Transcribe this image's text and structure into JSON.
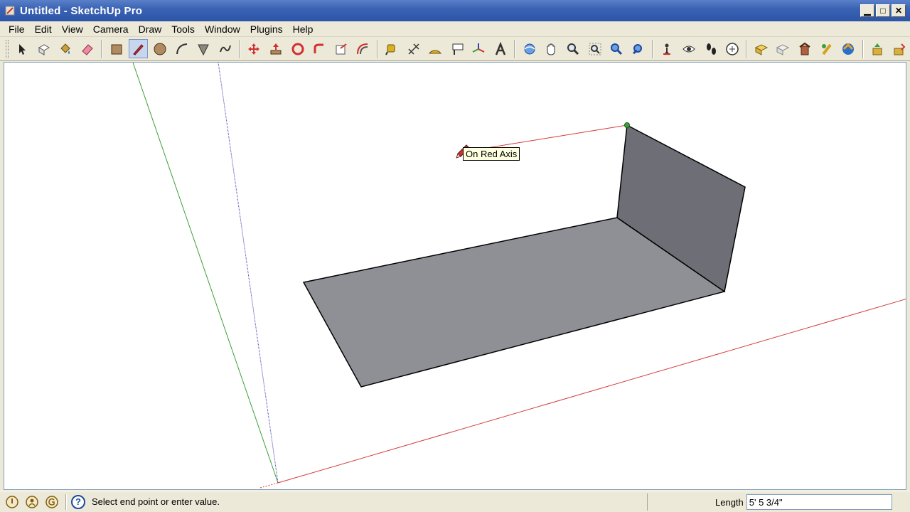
{
  "window": {
    "title": "Untitled - SketchUp Pro",
    "controls": {
      "minimize": "▁",
      "maximize": "□",
      "close": "✕"
    }
  },
  "menu": [
    "File",
    "Edit",
    "View",
    "Camera",
    "Draw",
    "Tools",
    "Window",
    "Plugins",
    "Help"
  ],
  "toolbar": {
    "icons": [
      "select-icon",
      "make-component-icon",
      "paint-bucket-icon",
      "eraser-icon",
      "rectangle-icon",
      "line-pencil-icon",
      "circle-icon",
      "arc-icon",
      "polygon-icon",
      "freehand-icon",
      "move-icon",
      "push-pull-icon",
      "rotate-icon",
      "follow-me-icon",
      "scale-icon",
      "offset-icon",
      "tape-measure-icon",
      "dimension-icon",
      "protractor-icon",
      "text-icon",
      "axes-icon",
      "3d-text-icon",
      "orbit-icon",
      "pan-icon",
      "zoom-icon",
      "zoom-window-icon",
      "zoom-extents-icon",
      "previous-view-icon",
      "position-camera-icon",
      "look-around-icon",
      "walk-icon",
      "section-plane-icon",
      "get-current-view-icon",
      "toggle-terrain-icon",
      "add-new-building-icon",
      "photo-textures-icon",
      "get-models-icon",
      "share-model-icon",
      "share-component-icon"
    ],
    "active_tool": "line-pencil-icon"
  },
  "viewport": {
    "tooltip": "On Red Axis",
    "colors": {
      "red_axis": "#d43c3c",
      "green_axis": "#3aa03a",
      "blue_axis": "#3b3bb0",
      "face_floor": "#8f9096",
      "face_wall": "#6e6e76",
      "endpoint": "#3aa03a"
    }
  },
  "status": {
    "message": "Select end point or enter value.",
    "measurement_label": "Length",
    "measurement_value": "5' 5 3/4\""
  }
}
